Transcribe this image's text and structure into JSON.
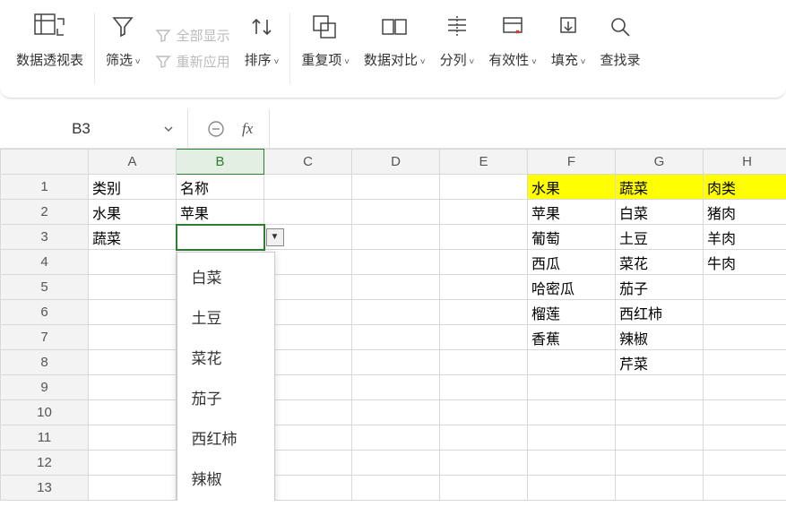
{
  "ribbon": {
    "pivot": "数据透视表",
    "filter": "筛选",
    "showAll": "全部显示",
    "reapply": "重新应用",
    "sort": "排序",
    "dup": "重复项",
    "compare": "数据对比",
    "split": "分列",
    "validity": "有效性",
    "fill": "填充",
    "findRec": "查找录"
  },
  "namebox": "B3",
  "fx": "fx",
  "cols": [
    "A",
    "B",
    "C",
    "D",
    "E",
    "F",
    "G",
    "H"
  ],
  "activeCol": "B",
  "activeRow": 3,
  "grid": {
    "A1": "类别",
    "B1": "名称",
    "A2": "水果",
    "B2": "苹果",
    "A3": "蔬菜",
    "F1": "水果",
    "G1": "蔬菜",
    "H1": "肉类",
    "F2": "苹果",
    "G2": "白菜",
    "H2": "猪肉",
    "F3": "葡萄",
    "G3": "土豆",
    "H3": "羊肉",
    "F4": "西瓜",
    "G4": "菜花",
    "H4": "牛肉",
    "F5": "哈密瓜",
    "G5": "茄子",
    "F6": "榴莲",
    "G6": "西红柿",
    "F7": "香蕉",
    "G7": "辣椒",
    "G8": "芹菜"
  },
  "yellowCells": [
    "F1",
    "G1",
    "H1"
  ],
  "dropdown": {
    "items": [
      "白菜",
      "土豆",
      "菜花",
      "茄子",
      "西红柿",
      "辣椒"
    ]
  },
  "rowCount": 13
}
